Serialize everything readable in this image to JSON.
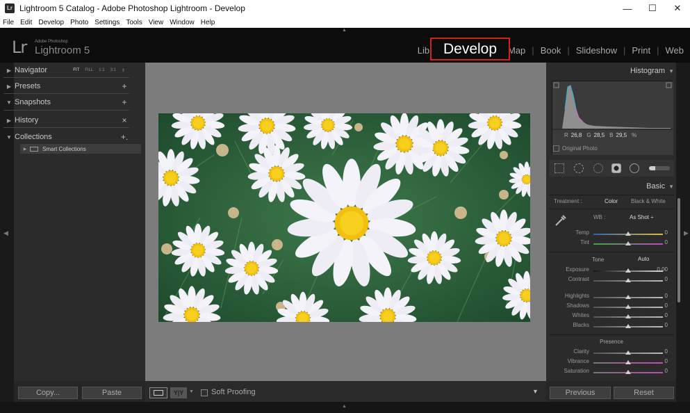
{
  "window": {
    "title": "Lightroom 5 Catalog - Adobe Photoshop Lightroom - Develop",
    "app_icon": "Lr",
    "minimize": "—",
    "maximize": "☐",
    "close": "✕"
  },
  "menu": [
    "File",
    "Edit",
    "Develop",
    "Photo",
    "Settings",
    "Tools",
    "View",
    "Window",
    "Help"
  ],
  "brand": {
    "mark": "Lr",
    "sub": "Adobe Photoshop",
    "name": "Lightroom 5"
  },
  "modules": {
    "library": "Library",
    "develop": "Develop",
    "map": "Map",
    "book": "Book",
    "slideshow": "Slideshow",
    "print": "Print",
    "web": "Web"
  },
  "left_panel": {
    "navigator": "Navigator",
    "nav_options": [
      "FIT",
      "FILL",
      "1:1",
      "3:1"
    ],
    "presets": "Presets",
    "snapshots": "Snapshots",
    "history": "History",
    "collections": "Collections",
    "smart_collections": "Smart Collections",
    "copy_button": "Copy...",
    "paste_button": "Paste"
  },
  "toolbar": {
    "view_yy": "Y|Y",
    "soft_proofing": "Soft Proofing"
  },
  "right_panel": {
    "histogram": "Histogram",
    "readout": {
      "r_label": "R",
      "r": "26,8",
      "g_label": "G",
      "g": "28,5",
      "b_label": "B",
      "b": "29,5",
      "unit": "%"
    },
    "original_photo": "Original Photo",
    "basic": "Basic",
    "treatment_label": "Treatment :",
    "treatment_color": "Color",
    "treatment_bw": "Black & White",
    "wb_label": "WB :",
    "wb_value": "As Shot ÷",
    "tone": "Tone",
    "auto": "Auto",
    "presence": "Presence",
    "previous_button": "Previous",
    "reset_button": "Reset",
    "sliders": {
      "temp": {
        "label": "Temp",
        "value": "0",
        "position": 0.5
      },
      "tint": {
        "label": "Tint",
        "value": "0",
        "position": 0.5
      },
      "exposure": {
        "label": "Exposure",
        "value": "0,00",
        "position": 0.5
      },
      "contrast": {
        "label": "Contrast",
        "value": "0",
        "position": 0.5
      },
      "highlights": {
        "label": "Highlights",
        "value": "0",
        "position": 0.5
      },
      "shadows": {
        "label": "Shadows",
        "value": "0",
        "position": 0.5
      },
      "whites": {
        "label": "Whites",
        "value": "0",
        "position": 0.5
      },
      "blacks": {
        "label": "Blacks",
        "value": "0",
        "position": 0.5
      },
      "clarity": {
        "label": "Clarity",
        "value": "0",
        "position": 0.5
      },
      "vibrance": {
        "label": "Vibrance",
        "value": "0",
        "position": 0.5
      },
      "saturation": {
        "label": "Saturation",
        "value": "0",
        "position": 0.5
      }
    }
  },
  "colors": {
    "highlight_border": "#d61f1f",
    "panel_bg": "#2b2b2b",
    "canvas_bg": "#7c7c7c"
  }
}
